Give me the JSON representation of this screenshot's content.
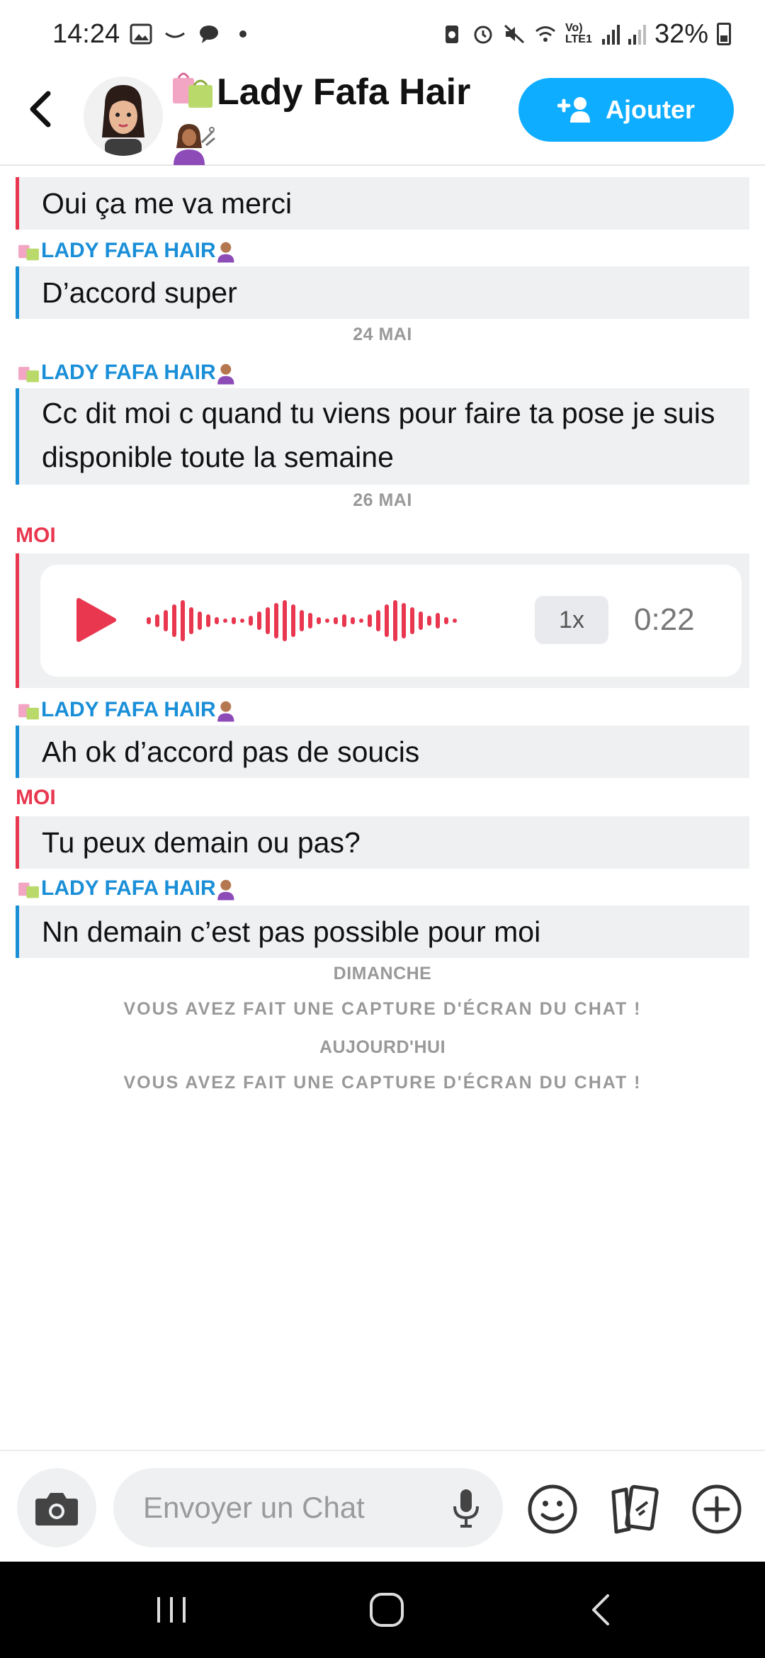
{
  "status_bar": {
    "time": "14:24",
    "network": "Vo) LTE1",
    "battery": "32%"
  },
  "header": {
    "title": "Lady Fafa Hair",
    "add_button_label": "Ajouter"
  },
  "messages": [
    {
      "type": "text",
      "color": "red",
      "text": "Oui ça me va merci"
    },
    {
      "type": "sender",
      "color": "blue",
      "text": "LADY FAFA HAIR"
    },
    {
      "type": "text",
      "color": "blue",
      "text": "D’accord super"
    },
    {
      "type": "date",
      "text": "24 MAI"
    },
    {
      "type": "sender",
      "color": "blue",
      "text": "LADY FAFA HAIR"
    },
    {
      "type": "text",
      "color": "blue",
      "text": "Cc dit moi c quand tu viens pour faire ta pose je suis disponible toute la semaine"
    },
    {
      "type": "date",
      "text": "26 MAI"
    },
    {
      "type": "sender",
      "color": "red",
      "text": "MOI"
    },
    {
      "type": "voice",
      "speed": "1x",
      "duration": "0:22"
    },
    {
      "type": "sender",
      "color": "blue",
      "text": "LADY FAFA HAIR"
    },
    {
      "type": "text",
      "color": "blue",
      "text": "Ah ok d’accord pas de soucis"
    },
    {
      "type": "sender",
      "color": "red",
      "text": "MOI"
    },
    {
      "type": "text",
      "color": "red",
      "text": "Tu peux demain ou pas?"
    },
    {
      "type": "sender",
      "color": "blue",
      "text": "LADY FAFA HAIR"
    },
    {
      "type": "text",
      "color": "blue",
      "text": "Nn demain c’est pas possible pour moi"
    },
    {
      "type": "date",
      "text": "DIMANCHE"
    },
    {
      "type": "notice",
      "text": "VOUS AVEZ FAIT UNE CAPTURE D'ÉCRAN DU CHAT !"
    },
    {
      "type": "date",
      "text": "AUJOURD'HUI"
    },
    {
      "type": "notice",
      "text": "VOUS AVEZ FAIT UNE CAPTURE D'ÉCRAN DU CHAT !"
    }
  ],
  "composer": {
    "placeholder": "Envoyer un Chat"
  },
  "colors": {
    "accent_blue": "#0EADFF",
    "friend_blue": "#1a8fd8",
    "me_red": "#e8374f"
  },
  "icons": {
    "back": "chevron-left-icon",
    "add_friend": "add-user-icon",
    "play": "play-icon",
    "camera": "camera-icon",
    "mic": "microphone-icon",
    "emoji": "smiley-icon",
    "stickers": "cards-icon",
    "plus": "plus-circle-icon"
  }
}
